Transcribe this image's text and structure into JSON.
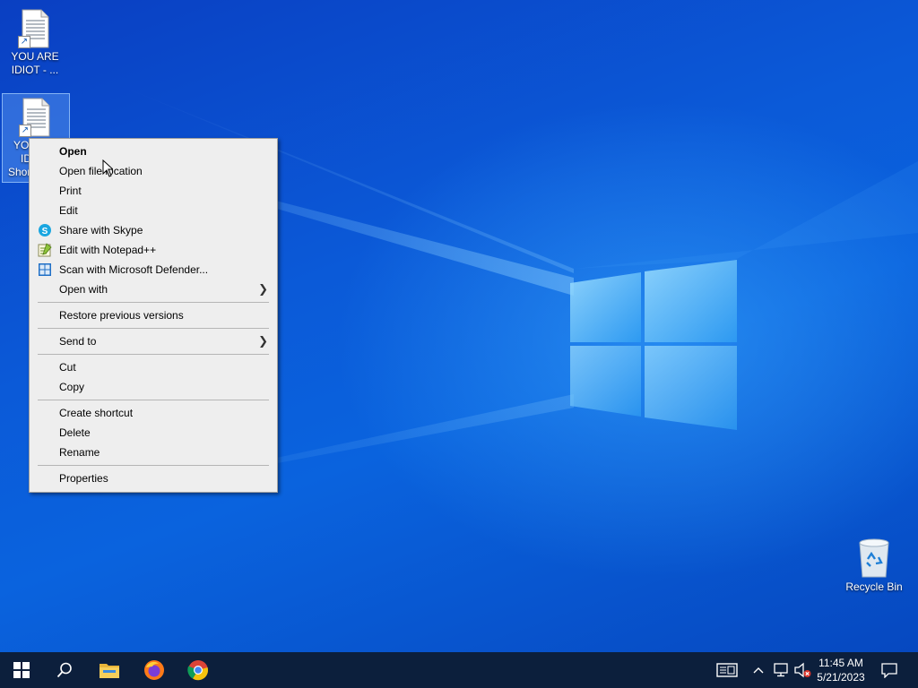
{
  "desktop": {
    "icons": [
      {
        "label": "YOU ARE IDIOT - ..."
      },
      {
        "label_line1": "YO",
        "label_line2": "ID",
        "label_line3": "Shor"
      }
    ],
    "recycle_bin": {
      "label": "Recycle Bin"
    }
  },
  "context_menu": {
    "items": [
      {
        "label": "Open"
      },
      {
        "label": "Open file location"
      },
      {
        "label": "Print"
      },
      {
        "label": "Edit"
      },
      {
        "label": "Share with Skype",
        "icon": "skype-icon"
      },
      {
        "label": "Edit with Notepad++",
        "icon": "notepadpp-icon"
      },
      {
        "label": "Scan with Microsoft Defender...",
        "icon": "defender-icon"
      },
      {
        "label": "Open with"
      },
      {
        "label": "Restore previous versions"
      },
      {
        "label": "Send to"
      },
      {
        "label": "Cut"
      },
      {
        "label": "Copy"
      },
      {
        "label": "Create shortcut"
      },
      {
        "label": "Delete"
      },
      {
        "label": "Rename"
      },
      {
        "label": "Properties"
      }
    ]
  },
  "taskbar": {
    "buttons": [
      "start-icon",
      "search-icon",
      "file-explorer-icon",
      "firefox-icon",
      "chrome-icon"
    ],
    "tray": [
      "news-icon",
      "chevron-up-icon",
      "network-icon",
      "volume-muted-icon",
      "notification-icon"
    ],
    "clock": {
      "time": "11:45 AM",
      "date": "5/21/2023"
    }
  },
  "colors": {
    "taskbar": "#0c1f3c",
    "menu_bg": "#eeeeee",
    "wallpaper_blue": "#0b5ad8"
  }
}
